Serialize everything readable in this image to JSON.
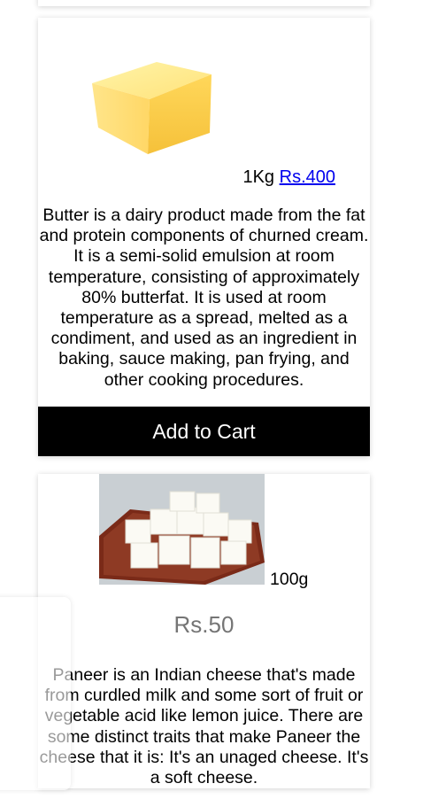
{
  "butter": {
    "image_alt": "Butter block",
    "quantity": "1Kg",
    "price_link": "Rs.400",
    "description": "Butter is a dairy product made from the fat and protein components of churned cream. It is a semi-solid emulsion at room temperature, consisting of approximately 80% butterfat. It is used at room temperature as a spread, melted as a condiment, and used as an ingredient in baking, sauce making, pan frying, and other cooking procedures.",
    "button_label": "Add to Cart"
  },
  "paneer": {
    "image_alt": "Paneer cubes",
    "quantity": "100g",
    "price": "Rs.50",
    "description": "Paneer is an Indian cheese that's made from curdled milk and some sort of fruit or vegetable acid like lemon juice. There are some distinct traits that make Paneer the cheese that it is: It's an unaged cheese. It's a soft cheese."
  }
}
